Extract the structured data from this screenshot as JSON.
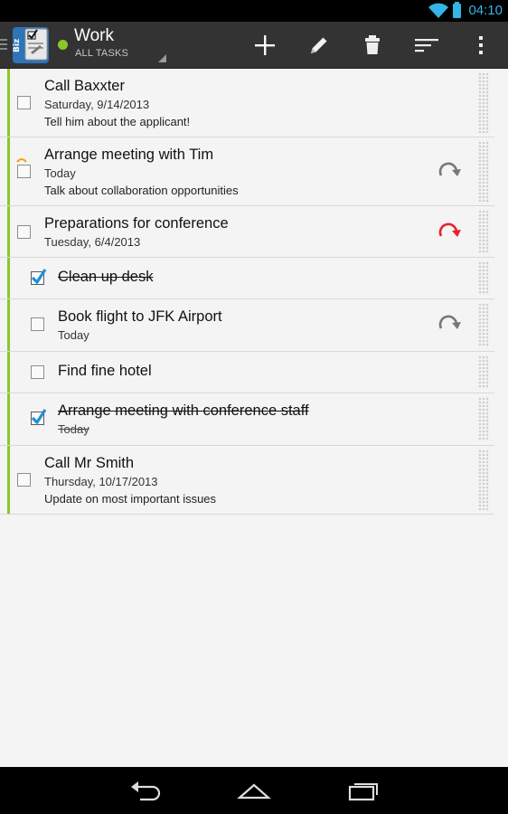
{
  "status_bar": {
    "time": "04:10",
    "wifi_icon": "wifi-icon",
    "battery_icon": "battery-icon",
    "accent": "#33b5e5"
  },
  "action_bar": {
    "app_icon": "biz-app-icon",
    "list_title": "Work",
    "list_subtitle": "ALL TASKS",
    "list_color": "#8bc727",
    "actions": [
      {
        "name": "add-icon"
      },
      {
        "name": "edit-icon"
      },
      {
        "name": "delete-icon"
      },
      {
        "name": "sort-icon"
      },
      {
        "name": "overflow-menu-icon"
      }
    ]
  },
  "tasks": [
    {
      "title": "Call Baxxter",
      "date": "Saturday, 9/14/2013",
      "note": "Tell him about the applicant!",
      "completed": false,
      "subtask": false
    },
    {
      "title": "Arrange meeting with Tim",
      "date": "Today",
      "note": "Talk about collaboration opportunities",
      "completed": false,
      "subtask": false,
      "priority_icon": "priority-low-icon",
      "repeat_icon": "repeat-icon"
    },
    {
      "title": "Preparations for conference",
      "date": "Tuesday, 6/4/2013",
      "completed": false,
      "subtask": false,
      "repeat_icon": "repeat-overdue-icon",
      "repeat_color": "#e8212a"
    },
    {
      "title": "Clean up desk",
      "completed": true,
      "subtask": true
    },
    {
      "title": "Book flight to JFK Airport",
      "date": "Today",
      "completed": false,
      "subtask": true,
      "repeat_icon": "repeat-icon"
    },
    {
      "title": "Find fine hotel",
      "completed": false,
      "subtask": true
    },
    {
      "title": "Arrange meeting with conference staff",
      "date": "Today",
      "completed": true,
      "subtask": true
    },
    {
      "title": "Call Mr Smith",
      "date": "Thursday, 10/17/2013",
      "note": "Update on most important issues",
      "completed": false,
      "subtask": false
    }
  ],
  "nav_bar": {
    "buttons": [
      "back-icon",
      "home-icon",
      "recent-apps-icon"
    ]
  }
}
